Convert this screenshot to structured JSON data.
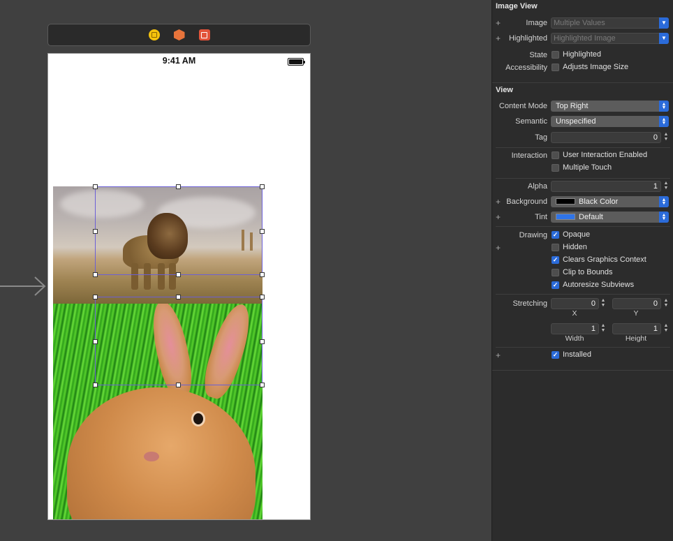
{
  "canvas": {
    "status_time": "9:41 AM"
  },
  "inspector": {
    "image_view": {
      "title": "Image View",
      "image_label": "Image",
      "image_placeholder": "Multiple Values",
      "highlighted_label": "Highlighted",
      "highlighted_placeholder": "Highlighted Image",
      "state_label": "State",
      "state_checkbox": "Highlighted",
      "state_checked": false,
      "accessibility_label": "Accessibility",
      "accessibility_checkbox": "Adjusts Image Size",
      "accessibility_checked": false
    },
    "view": {
      "title": "View",
      "content_mode_label": "Content Mode",
      "content_mode_value": "Top Right",
      "semantic_label": "Semantic",
      "semantic_value": "Unspecified",
      "tag_label": "Tag",
      "tag_value": "0",
      "interaction_label": "Interaction",
      "interaction_options": [
        {
          "label": "User Interaction Enabled",
          "checked": false
        },
        {
          "label": "Multiple Touch",
          "checked": false
        }
      ],
      "alpha_label": "Alpha",
      "alpha_value": "1",
      "background_label": "Background",
      "background_value": "Black Color",
      "background_color": "#000000",
      "tint_label": "Tint",
      "tint_value": "Default",
      "tint_color": "#2f74e8",
      "drawing_label": "Drawing",
      "drawing_options": [
        {
          "label": "Opaque",
          "checked": true
        },
        {
          "label": "Hidden",
          "checked": false
        },
        {
          "label": "Clears Graphics Context",
          "checked": true
        },
        {
          "label": "Clip to Bounds",
          "checked": false
        },
        {
          "label": "Autoresize Subviews",
          "checked": true
        }
      ],
      "stretching_label": "Stretching",
      "stretch_x": "0",
      "stretch_y": "0",
      "stretch_x_label": "X",
      "stretch_y_label": "Y",
      "stretch_width": "1",
      "stretch_height": "1",
      "width_label": "Width",
      "height_label": "Height",
      "installed_label": "Installed",
      "installed_checked": true
    }
  },
  "colors": {
    "accent": "#2b6bd9",
    "selection": "#6b5fd6"
  }
}
